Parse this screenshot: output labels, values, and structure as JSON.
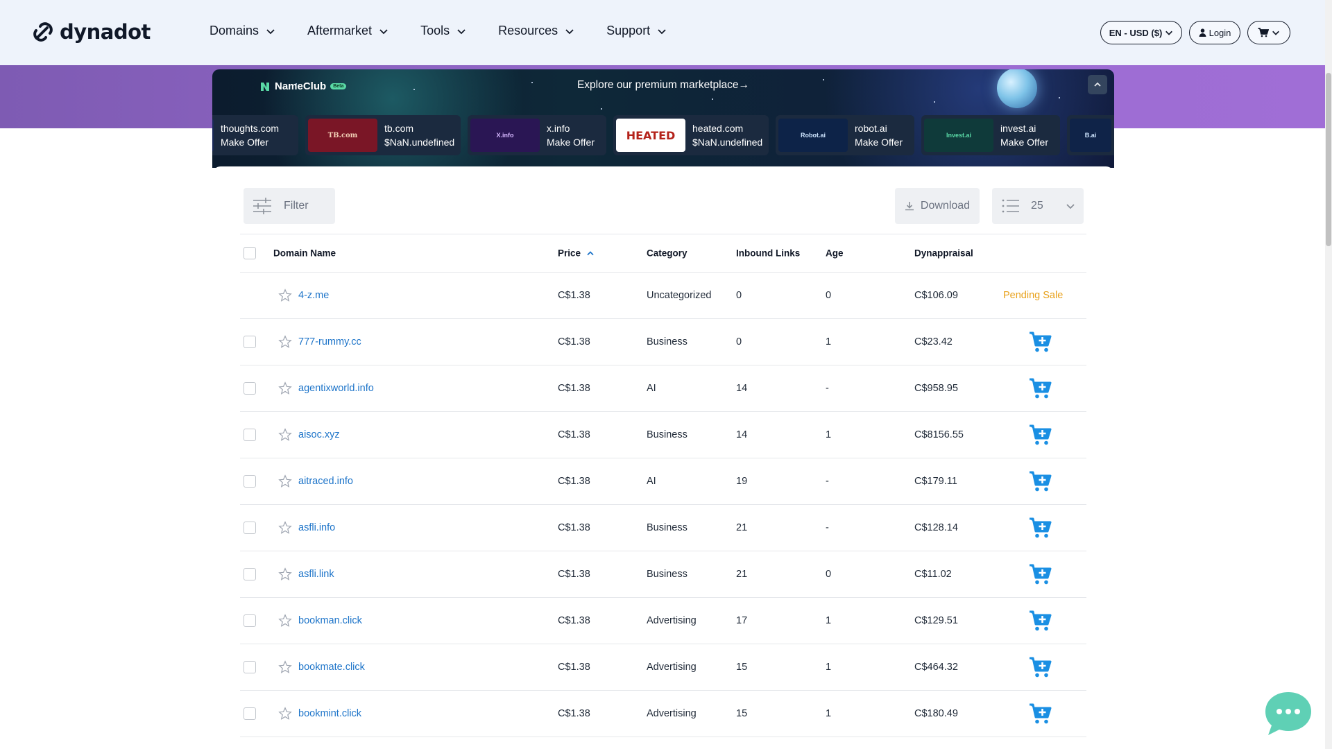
{
  "header": {
    "brand": "dynadot",
    "nav": [
      {
        "label": "Domains"
      },
      {
        "label": "Aftermarket"
      },
      {
        "label": "Tools"
      },
      {
        "label": "Resources"
      },
      {
        "label": "Support"
      }
    ],
    "lang_currency": "EN - USD ($)",
    "login": "Login"
  },
  "banner": {
    "brand": "NameClub",
    "badge": "Beta",
    "explore": "Explore our premium marketplace→",
    "cards": [
      {
        "name": "thoughts.com",
        "sub": "Make Offer",
        "logo": "",
        "logo_bg": "#1a2a5a"
      },
      {
        "name": "tb.com",
        "sub": "$NaN.undefined",
        "logo": "TB.com",
        "logo_bg": "#7a1626"
      },
      {
        "name": "x.info",
        "sub": "Make Offer",
        "logo": "X.info",
        "logo_bg": "#2a1654"
      },
      {
        "name": "heated.com",
        "sub": "$NaN.undefined",
        "logo": "HEATED",
        "logo_bg": "#ffffff"
      },
      {
        "name": "robot.ai",
        "sub": "Make Offer",
        "logo": "Robot.ai",
        "logo_bg": "#0d2348"
      },
      {
        "name": "invest.ai",
        "sub": "Make Offer",
        "logo": "Invest.ai",
        "logo_bg": "#0f3a3a"
      },
      {
        "name": "",
        "sub": "",
        "logo": "B.ai",
        "logo_bg": "#0f2348"
      }
    ]
  },
  "toolbar": {
    "filter": "Filter",
    "download": "Download",
    "per_page": "25"
  },
  "table": {
    "columns": {
      "domain": "Domain Name",
      "price": "Price",
      "category": "Category",
      "inbound": "Inbound Links",
      "age": "Age",
      "appraisal": "Dynappraisal"
    },
    "rows": [
      {
        "domain": "4-z.me",
        "price": "C$1.38",
        "category": "Uncategorized",
        "inbound": "0",
        "age": "0",
        "appraisal": "C$106.09",
        "status": "Pending Sale"
      },
      {
        "domain": "777-rummy.cc",
        "price": "C$1.38",
        "category": "Business",
        "inbound": "0",
        "age": "1",
        "appraisal": "C$23.42",
        "status": ""
      },
      {
        "domain": "agentixworld.info",
        "price": "C$1.38",
        "category": "AI",
        "inbound": "14",
        "age": "-",
        "appraisal": "C$958.95",
        "status": ""
      },
      {
        "domain": "aisoc.xyz",
        "price": "C$1.38",
        "category": "Business",
        "inbound": "14",
        "age": "1",
        "appraisal": "C$8156.55",
        "status": ""
      },
      {
        "domain": "aitraced.info",
        "price": "C$1.38",
        "category": "AI",
        "inbound": "19",
        "age": "-",
        "appraisal": "C$179.11",
        "status": ""
      },
      {
        "domain": "asfli.info",
        "price": "C$1.38",
        "category": "Business",
        "inbound": "21",
        "age": "-",
        "appraisal": "C$128.14",
        "status": ""
      },
      {
        "domain": "asfli.link",
        "price": "C$1.38",
        "category": "Business",
        "inbound": "21",
        "age": "0",
        "appraisal": "C$11.02",
        "status": ""
      },
      {
        "domain": "bookman.click",
        "price": "C$1.38",
        "category": "Advertising",
        "inbound": "17",
        "age": "1",
        "appraisal": "C$129.51",
        "status": ""
      },
      {
        "domain": "bookmate.click",
        "price": "C$1.38",
        "category": "Advertising",
        "inbound": "15",
        "age": "1",
        "appraisal": "C$464.32",
        "status": ""
      },
      {
        "domain": "bookmint.click",
        "price": "C$1.38",
        "category": "Advertising",
        "inbound": "15",
        "age": "1",
        "appraisal": "C$180.49",
        "status": ""
      }
    ]
  },
  "colors": {
    "link": "#1d74c9",
    "pending": "#e8a11a",
    "cart": "#1a8fe3",
    "chat": "#5fd0b5"
  }
}
